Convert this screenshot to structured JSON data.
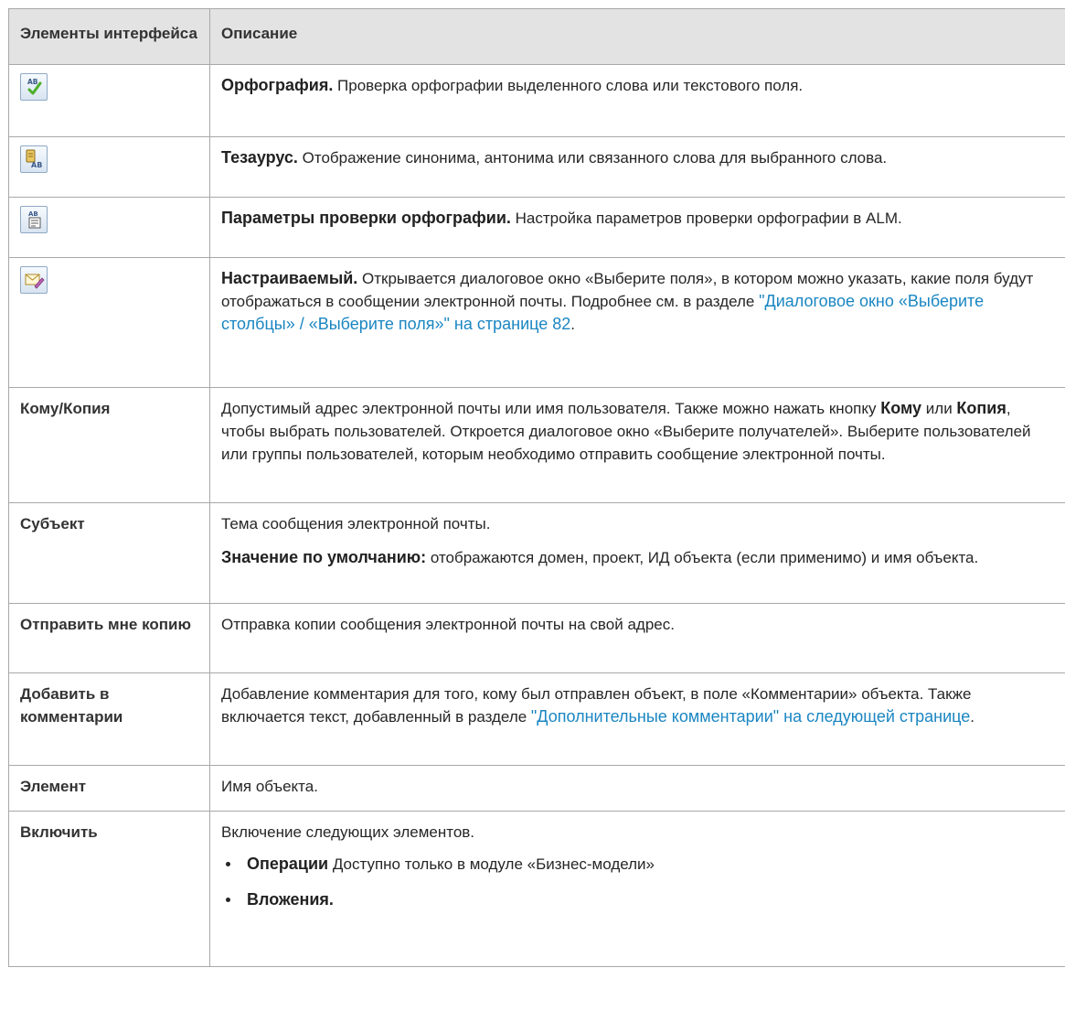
{
  "header": {
    "col1": "Элементы интерфейса",
    "col2": "Описание"
  },
  "rows": {
    "spelling": {
      "icon": "spell-check-icon",
      "title": "Орфография.",
      "text": " Проверка орфографии выделенного слова или текстового поля."
    },
    "thesaurus": {
      "icon": "thesaurus-icon",
      "title": "Тезаурус.",
      "text": " Отображение синонима, антонима или связанного слова для выбранного слова."
    },
    "spell_options": {
      "icon": "spelling-options-icon",
      "title": "Параметры проверки орфографии.",
      "text": " Настройка параметров проверки орфографии в ALM."
    },
    "custom": {
      "icon": "custom-fields-icon",
      "title": "Настраиваемый.",
      "text": " Открывается диалоговое окно «Выберите поля», в котором можно указать, какие поля будут отображаться в сообщении электронной почты. Подробнее см. в разделе ",
      "link": "\"Диалоговое окно «Выберите столбцы» / «Выберите поля»\" на странице 82",
      "end": "."
    },
    "to_cc": {
      "label": "Кому/Копия",
      "t1": "Допустимый адрес электронной почты или имя пользователя. Также можно нажать кнопку ",
      "b1": "Кому",
      "t2": " или ",
      "b2": "Копия",
      "t3": ", чтобы выбрать пользователей. Откроется диалоговое окно «Выберите получателей». Выберите пользователей или группы пользователей, которым необходимо отправить сообщение электронной почты."
    },
    "subject": {
      "label": "Субъект",
      "text": "Тема сообщения электронной почты.",
      "default_label": "Значение по умолчанию:",
      "default_text": " отображаются домен, проект, ИД объекта (если применимо) и имя объекта."
    },
    "send_me": {
      "label": "Отправить мне копию",
      "text": "Отправка копии сообщения электронной почты на свой адрес."
    },
    "add_comments": {
      "label": "Добавить в комментарии",
      "text": "Добавление комментария для того, кому был отправлен объект, в поле «Комментарии» объекта. Также включается текст, добавленный в разделе ",
      "link": "\"Дополнительные комментарии\" на следующей странице",
      "end": "."
    },
    "element": {
      "label": "Элемент",
      "text": "Имя объекта."
    },
    "include": {
      "label": "Включить",
      "text": "Включение следующих элементов.",
      "bullets": [
        {
          "bold": "Операции",
          "text": " Доступно только в модуле «Бизнес-модели»"
        },
        {
          "bold": "Вложения.",
          "text": ""
        }
      ]
    }
  }
}
